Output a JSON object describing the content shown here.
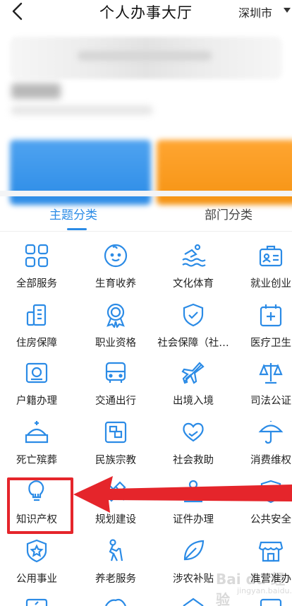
{
  "header": {
    "title": "个人办事大厅",
    "city": "深圳市"
  },
  "tabs": [
    {
      "label": "主题分类",
      "active": true
    },
    {
      "label": "部门分类",
      "active": false
    }
  ],
  "services": [
    {
      "label": "全部服务",
      "icon": "grid-icon"
    },
    {
      "label": "生育收养",
      "icon": "baby-face-icon"
    },
    {
      "label": "文化体育",
      "icon": "swimmer-icon"
    },
    {
      "label": "就业创业",
      "icon": "briefcase-id-icon"
    },
    {
      "label": "住房保障",
      "icon": "building-icon"
    },
    {
      "label": "职业资格",
      "icon": "award-medal-icon"
    },
    {
      "label": "社会保障（社…",
      "icon": "shield-check-icon"
    },
    {
      "label": "医疗卫生",
      "icon": "medical-cross-icon"
    },
    {
      "label": "户籍办理",
      "icon": "id-card-icon"
    },
    {
      "label": "交通出行",
      "icon": "bus-icon"
    },
    {
      "label": "出境入境",
      "icon": "airplane-icon"
    },
    {
      "label": "司法公证",
      "icon": "scales-icon"
    },
    {
      "label": "死亡殡葬",
      "icon": "tomb-icon"
    },
    {
      "label": "民族宗教",
      "icon": "frame-icon"
    },
    {
      "label": "社会救助",
      "icon": "heart-hands-icon"
    },
    {
      "label": "消费维权",
      "icon": "umbrella-icon"
    },
    {
      "label": "知识产权",
      "icon": "lightbulb-icon"
    },
    {
      "label": "规划建设",
      "icon": "ruler-pencil-icon"
    },
    {
      "label": "证件办理",
      "icon": "stamp-icon"
    },
    {
      "label": "公共安全",
      "icon": "shield-s-icon"
    },
    {
      "label": "公用事业",
      "icon": "shield-star-icon"
    },
    {
      "label": "养老服务",
      "icon": "elder-walker-icon"
    },
    {
      "label": "涉农补贴",
      "icon": "leaf-icon"
    },
    {
      "label": "准营准办",
      "icon": "shop-icon"
    }
  ],
  "watermark": {
    "text": "Bai du 经验",
    "sub": "jingyan.baidu.com"
  },
  "colors": {
    "accent": "#2b8be6",
    "highlight": "#e5252b",
    "card_blue": "#3b96ec",
    "card_orange": "#f99b1f"
  }
}
